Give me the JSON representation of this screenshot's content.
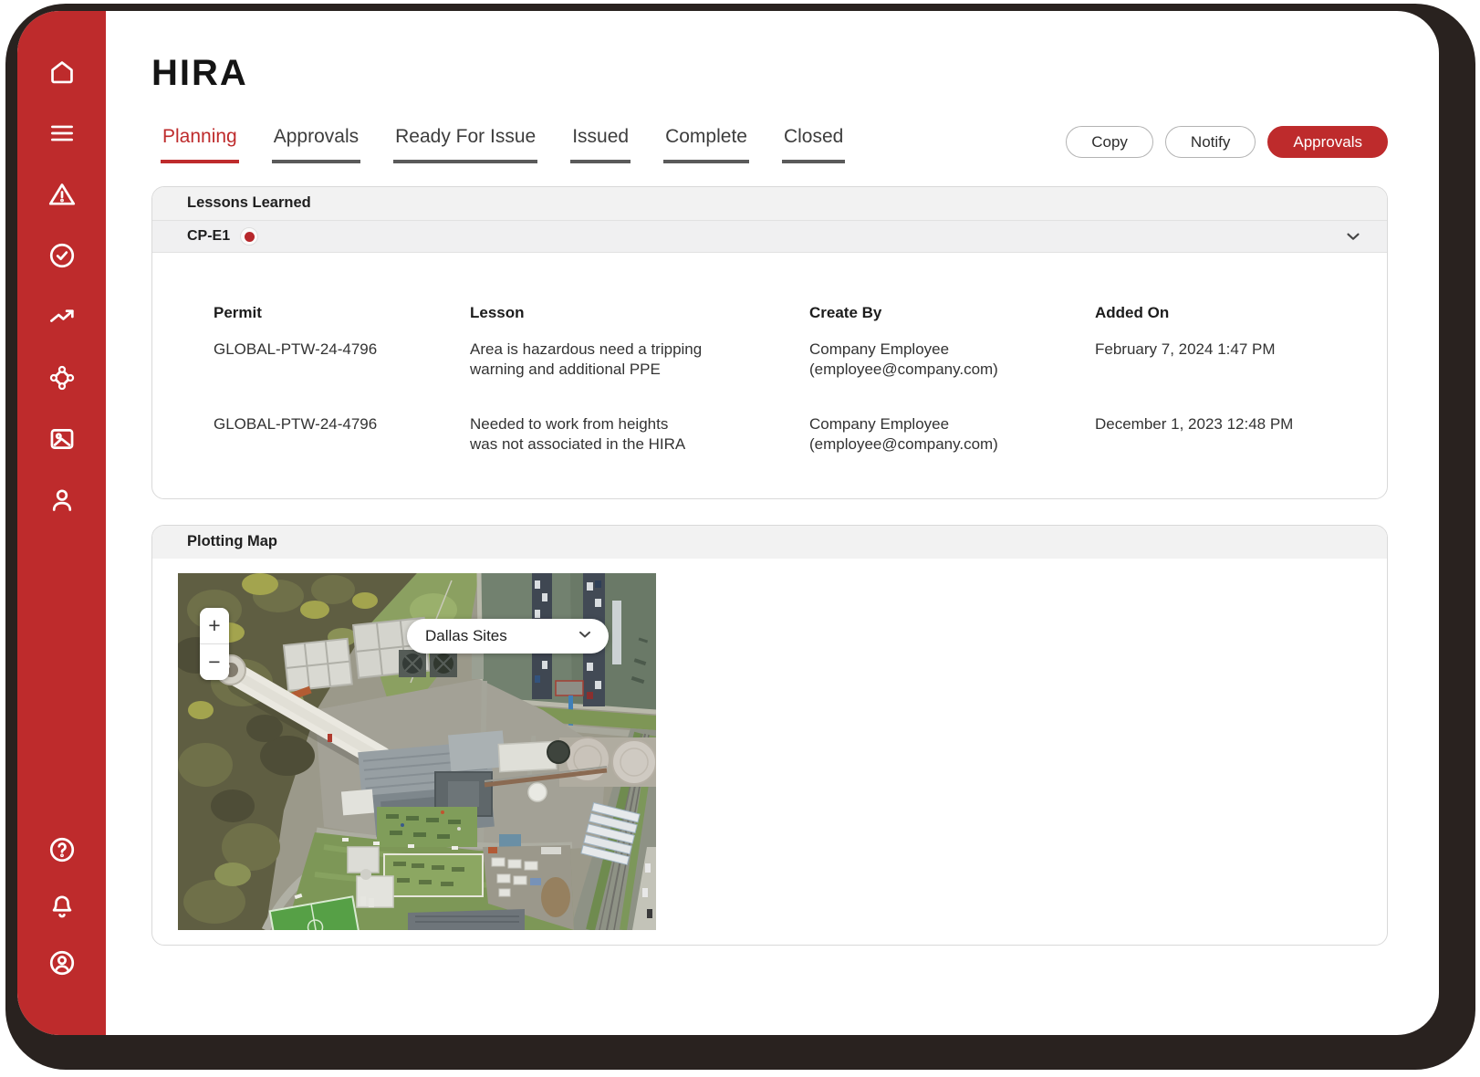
{
  "app": {
    "title": "HIRA",
    "tabs": [
      {
        "label": "Planning",
        "active": true
      },
      {
        "label": "Approvals",
        "active": false
      },
      {
        "label": "Ready For Issue",
        "active": false
      },
      {
        "label": "Issued",
        "active": false
      },
      {
        "label": "Complete",
        "active": false
      },
      {
        "label": "Closed",
        "active": false
      }
    ],
    "actions": {
      "copy": "Copy",
      "notify": "Notify",
      "approvals": "Approvals"
    }
  },
  "sidebar": {
    "top_icons": [
      "home-icon",
      "menu-icon",
      "alert-triangle-icon",
      "check-circle-icon",
      "trending-up-icon",
      "hub-icon",
      "image-icon",
      "user-icon"
    ],
    "bottom_icons": [
      "help-icon",
      "bell-icon",
      "account-icon"
    ]
  },
  "lessons": {
    "title": "Lessons Learned",
    "group": "CP-E1",
    "columns": [
      "Permit",
      "Lesson",
      "Create By",
      "Added On"
    ],
    "rows": [
      {
        "permit": "GLOBAL-PTW-24-4796",
        "lesson_lines": [
          "Area is hazardous need a tripping",
          "warning and additional PPE"
        ],
        "created_by_name": "Company Employee",
        "created_by_email": "(employee@company.com)",
        "added_on": "February 7, 2024 1:47 PM"
      },
      {
        "permit": "GLOBAL-PTW-24-4796",
        "lesson_lines": [
          "Needed to work from heights",
          "was not associated in the HIRA"
        ],
        "created_by_name": "Company Employee",
        "created_by_email": "(employee@company.com)",
        "added_on": "December 1, 2023 12:48 PM"
      }
    ]
  },
  "map": {
    "title": "Plotting Map",
    "site_selector": "Dallas Sites",
    "zoom_in": "+",
    "zoom_out": "−"
  },
  "colors": {
    "brand_red": "#BE2B2C",
    "frame_dark": "#29221F",
    "panel_header_bg": "#F2F2F2",
    "panel_border": "#D9D9D9",
    "inactive_tab_underline": "#5A5A5A",
    "status_dot_red": "#B7282C"
  }
}
